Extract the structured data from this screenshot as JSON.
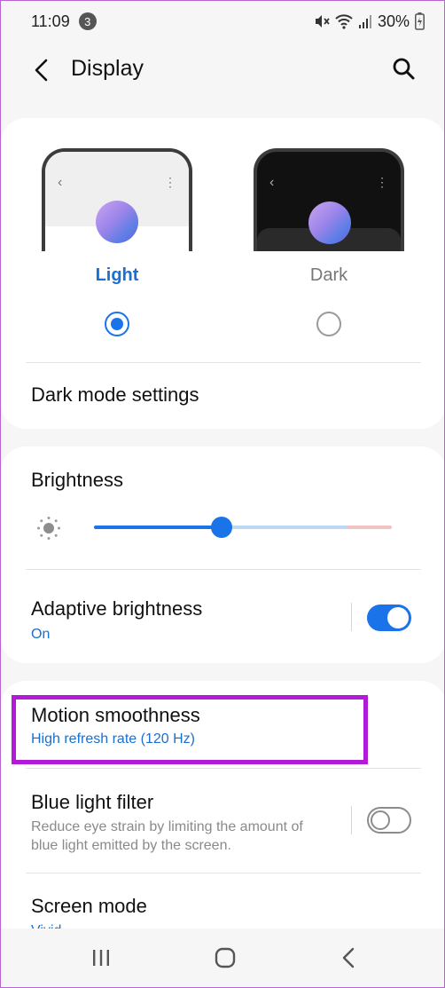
{
  "status_bar": {
    "time": "11:09",
    "notification_count": "3",
    "battery": "30%"
  },
  "header": {
    "title": "Display",
    "back_icon": "back-chevron-icon",
    "search_icon": "search-icon"
  },
  "theme": {
    "light_label": "Light",
    "dark_label": "Dark",
    "selected": "light"
  },
  "dark_mode_settings": {
    "label": "Dark mode settings"
  },
  "brightness": {
    "label": "Brightness",
    "level": 0.43
  },
  "adaptive_brightness": {
    "label": "Adaptive brightness",
    "status": "On",
    "enabled": true
  },
  "motion_smoothness": {
    "label": "Motion smoothness",
    "value": "High refresh rate (120 Hz)"
  },
  "blue_light_filter": {
    "label": "Blue light filter",
    "description": "Reduce eye strain by limiting the amount of blue light emitted by the screen.",
    "enabled": false
  },
  "screen_mode": {
    "label": "Screen mode",
    "value": "Vivid"
  },
  "colors": {
    "accent": "#1a73e8",
    "highlight": "#b21ad8"
  }
}
